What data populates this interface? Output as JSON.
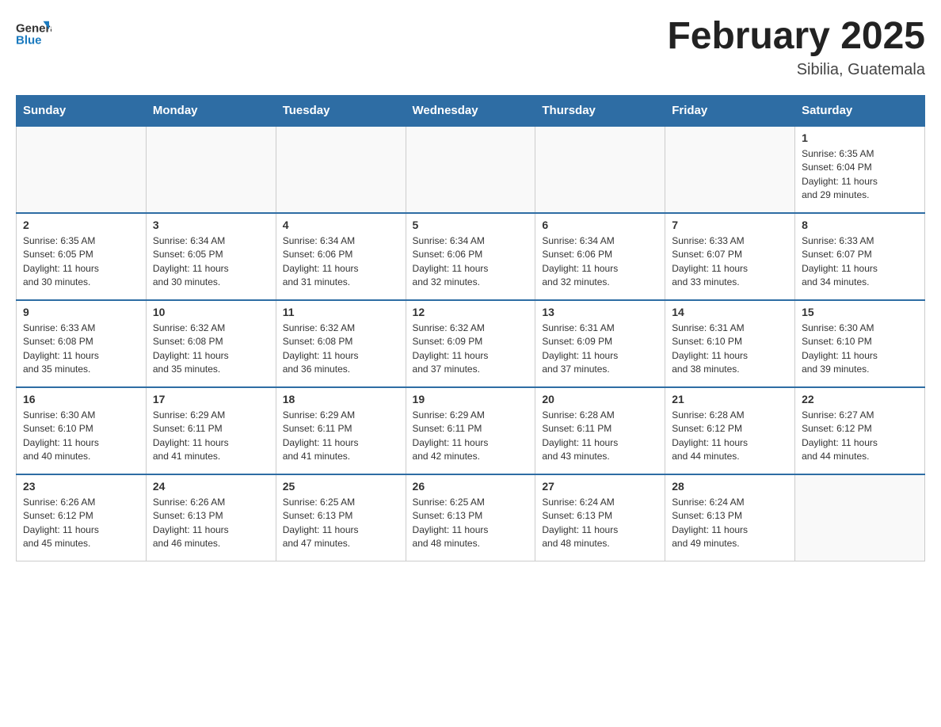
{
  "header": {
    "logo": {
      "text_general": "General",
      "text_blue": "Blue"
    },
    "title": "February 2025",
    "location": "Sibilia, Guatemala"
  },
  "weekdays": [
    "Sunday",
    "Monday",
    "Tuesday",
    "Wednesday",
    "Thursday",
    "Friday",
    "Saturday"
  ],
  "weeks": [
    [
      {
        "day": "",
        "info": ""
      },
      {
        "day": "",
        "info": ""
      },
      {
        "day": "",
        "info": ""
      },
      {
        "day": "",
        "info": ""
      },
      {
        "day": "",
        "info": ""
      },
      {
        "day": "",
        "info": ""
      },
      {
        "day": "1",
        "info": "Sunrise: 6:35 AM\nSunset: 6:04 PM\nDaylight: 11 hours\nand 29 minutes."
      }
    ],
    [
      {
        "day": "2",
        "info": "Sunrise: 6:35 AM\nSunset: 6:05 PM\nDaylight: 11 hours\nand 30 minutes."
      },
      {
        "day": "3",
        "info": "Sunrise: 6:34 AM\nSunset: 6:05 PM\nDaylight: 11 hours\nand 30 minutes."
      },
      {
        "day": "4",
        "info": "Sunrise: 6:34 AM\nSunset: 6:06 PM\nDaylight: 11 hours\nand 31 minutes."
      },
      {
        "day": "5",
        "info": "Sunrise: 6:34 AM\nSunset: 6:06 PM\nDaylight: 11 hours\nand 32 minutes."
      },
      {
        "day": "6",
        "info": "Sunrise: 6:34 AM\nSunset: 6:06 PM\nDaylight: 11 hours\nand 32 minutes."
      },
      {
        "day": "7",
        "info": "Sunrise: 6:33 AM\nSunset: 6:07 PM\nDaylight: 11 hours\nand 33 minutes."
      },
      {
        "day": "8",
        "info": "Sunrise: 6:33 AM\nSunset: 6:07 PM\nDaylight: 11 hours\nand 34 minutes."
      }
    ],
    [
      {
        "day": "9",
        "info": "Sunrise: 6:33 AM\nSunset: 6:08 PM\nDaylight: 11 hours\nand 35 minutes."
      },
      {
        "day": "10",
        "info": "Sunrise: 6:32 AM\nSunset: 6:08 PM\nDaylight: 11 hours\nand 35 minutes."
      },
      {
        "day": "11",
        "info": "Sunrise: 6:32 AM\nSunset: 6:08 PM\nDaylight: 11 hours\nand 36 minutes."
      },
      {
        "day": "12",
        "info": "Sunrise: 6:32 AM\nSunset: 6:09 PM\nDaylight: 11 hours\nand 37 minutes."
      },
      {
        "day": "13",
        "info": "Sunrise: 6:31 AM\nSunset: 6:09 PM\nDaylight: 11 hours\nand 37 minutes."
      },
      {
        "day": "14",
        "info": "Sunrise: 6:31 AM\nSunset: 6:10 PM\nDaylight: 11 hours\nand 38 minutes."
      },
      {
        "day": "15",
        "info": "Sunrise: 6:30 AM\nSunset: 6:10 PM\nDaylight: 11 hours\nand 39 minutes."
      }
    ],
    [
      {
        "day": "16",
        "info": "Sunrise: 6:30 AM\nSunset: 6:10 PM\nDaylight: 11 hours\nand 40 minutes."
      },
      {
        "day": "17",
        "info": "Sunrise: 6:29 AM\nSunset: 6:11 PM\nDaylight: 11 hours\nand 41 minutes."
      },
      {
        "day": "18",
        "info": "Sunrise: 6:29 AM\nSunset: 6:11 PM\nDaylight: 11 hours\nand 41 minutes."
      },
      {
        "day": "19",
        "info": "Sunrise: 6:29 AM\nSunset: 6:11 PM\nDaylight: 11 hours\nand 42 minutes."
      },
      {
        "day": "20",
        "info": "Sunrise: 6:28 AM\nSunset: 6:11 PM\nDaylight: 11 hours\nand 43 minutes."
      },
      {
        "day": "21",
        "info": "Sunrise: 6:28 AM\nSunset: 6:12 PM\nDaylight: 11 hours\nand 44 minutes."
      },
      {
        "day": "22",
        "info": "Sunrise: 6:27 AM\nSunset: 6:12 PM\nDaylight: 11 hours\nand 44 minutes."
      }
    ],
    [
      {
        "day": "23",
        "info": "Sunrise: 6:26 AM\nSunset: 6:12 PM\nDaylight: 11 hours\nand 45 minutes."
      },
      {
        "day": "24",
        "info": "Sunrise: 6:26 AM\nSunset: 6:13 PM\nDaylight: 11 hours\nand 46 minutes."
      },
      {
        "day": "25",
        "info": "Sunrise: 6:25 AM\nSunset: 6:13 PM\nDaylight: 11 hours\nand 47 minutes."
      },
      {
        "day": "26",
        "info": "Sunrise: 6:25 AM\nSunset: 6:13 PM\nDaylight: 11 hours\nand 48 minutes."
      },
      {
        "day": "27",
        "info": "Sunrise: 6:24 AM\nSunset: 6:13 PM\nDaylight: 11 hours\nand 48 minutes."
      },
      {
        "day": "28",
        "info": "Sunrise: 6:24 AM\nSunset: 6:13 PM\nDaylight: 11 hours\nand 49 minutes."
      },
      {
        "day": "",
        "info": ""
      }
    ]
  ]
}
